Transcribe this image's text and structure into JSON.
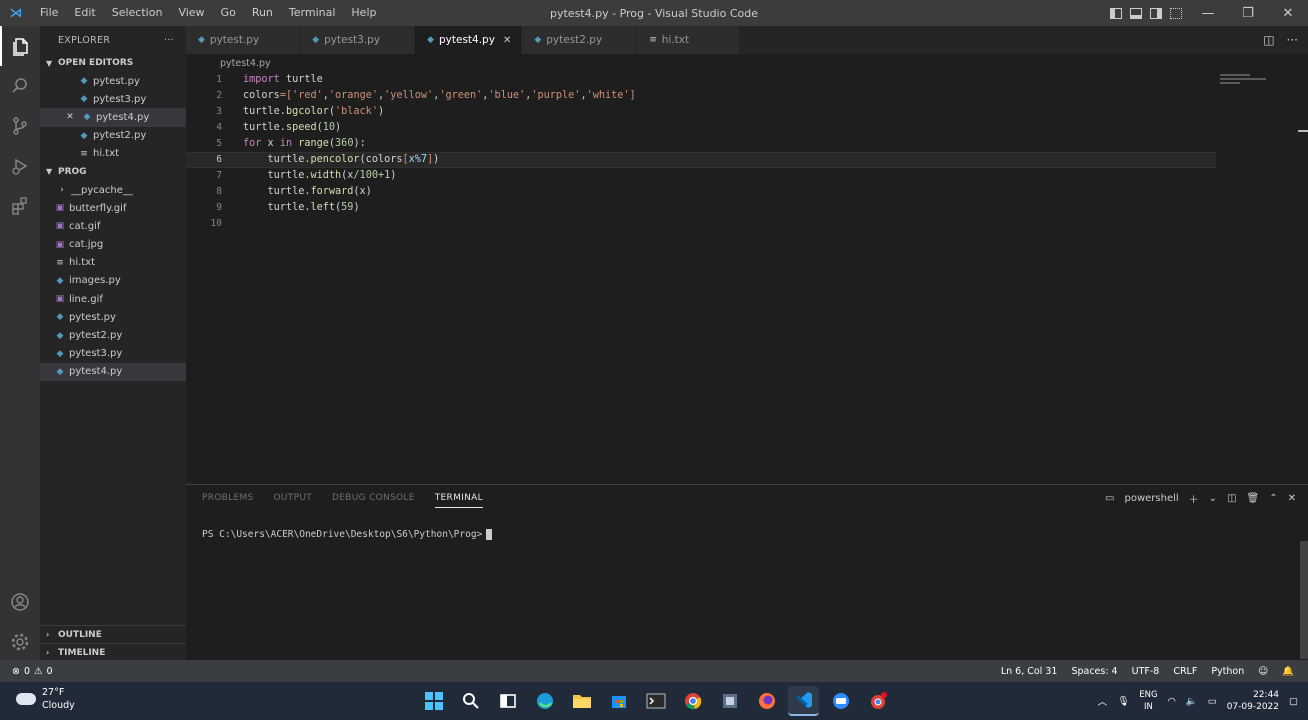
{
  "window": {
    "title": "pytest4.py - Prog - Visual Studio Code",
    "logo": "VS Code"
  },
  "menu": [
    "File",
    "Edit",
    "Selection",
    "View",
    "Go",
    "Run",
    "Terminal",
    "Help"
  ],
  "sidebar": {
    "header": "EXPLORER",
    "more": "···",
    "open_editors_title": "OPEN EDITORS",
    "open_editors": [
      {
        "name": "pytest.py",
        "icon": "python-file-icon"
      },
      {
        "name": "pytest3.py",
        "icon": "python-file-icon"
      },
      {
        "name": "pytest4.py",
        "icon": "python-file-icon",
        "close": "✕"
      },
      {
        "name": "pytest2.py",
        "icon": "python-file-icon"
      },
      {
        "name": "hi.txt",
        "icon": "text-file-icon"
      }
    ],
    "folder_title": "PROG",
    "files": [
      {
        "name": "__pycache__",
        "icon": "folder-chevron-icon"
      },
      {
        "name": "butterfly.gif",
        "icon": "image-file-icon"
      },
      {
        "name": "cat.gif",
        "icon": "image-file-icon"
      },
      {
        "name": "cat.jpg",
        "icon": "image-file-icon"
      },
      {
        "name": "hi.txt",
        "icon": "text-file-icon"
      },
      {
        "name": "images.py",
        "icon": "python-file-icon"
      },
      {
        "name": "line.gif",
        "icon": "image-file-icon"
      },
      {
        "name": "pytest.py",
        "icon": "python-file-icon"
      },
      {
        "name": "pytest2.py",
        "icon": "python-file-icon"
      },
      {
        "name": "pytest3.py",
        "icon": "python-file-icon"
      },
      {
        "name": "pytest4.py",
        "icon": "python-file-icon"
      }
    ],
    "outline": "OUTLINE",
    "timeline": "TIMELINE"
  },
  "tabs": [
    {
      "label": "pytest.py",
      "active": false
    },
    {
      "label": "pytest3.py",
      "active": false
    },
    {
      "label": "pytest4.py",
      "active": true,
      "close": "✕"
    },
    {
      "label": "pytest2.py",
      "active": false
    },
    {
      "label": "hi.txt",
      "active": false
    }
  ],
  "breadcrumb": "pytest4.py",
  "editor": {
    "line_numbers": [
      "1",
      "2",
      "3",
      "4",
      "5",
      "6",
      "7",
      "8",
      "9",
      "10"
    ],
    "current_line": 6
  },
  "panel": {
    "tabs": [
      "PROBLEMS",
      "OUTPUT",
      "DEBUG CONSOLE",
      "TERMINAL"
    ],
    "active_tab": "TERMINAL",
    "shell": "powershell",
    "prompt": "PS C:\\Users\\ACER\\OneDrive\\Desktop\\S6\\Python\\Prog>"
  },
  "statusbar": {
    "errors": "0",
    "warnings": "0",
    "position": "Ln 6, Col 31",
    "spaces": "Spaces: 4",
    "encoding": "UTF-8",
    "eol": "CRLF",
    "language": "Python"
  },
  "taskbar": {
    "temperature": "27°F",
    "weather": "Cloudy",
    "lang_top": "ENG",
    "lang_bottom": "IN",
    "time": "22:44",
    "date": "07-09-2022"
  }
}
